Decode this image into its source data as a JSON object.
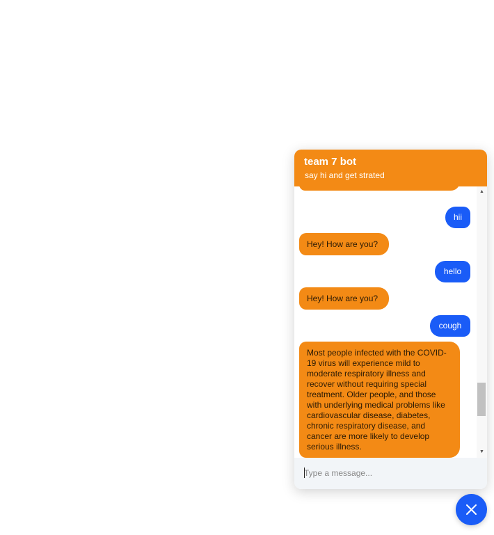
{
  "header": {
    "title": "team 7 bot",
    "subtitle": "say hi and get strated"
  },
  "messages": [
    {
      "sender": "user",
      "text": "hii"
    },
    {
      "sender": "bot",
      "text": "Hey! How are you?"
    },
    {
      "sender": "user",
      "text": "hello"
    },
    {
      "sender": "bot",
      "text": "Hey! How are you?"
    },
    {
      "sender": "user",
      "text": "cough"
    },
    {
      "sender": "bot",
      "text": "Most people infected with the COVID-19 virus will experience mild to moderate respiratory illness and recover without requiring special treatment. Older people, and those with underlying medical problems like cardiovascular disease, diabetes, chronic respiratory disease, and cancer are more likely to develop serious illness."
    }
  ],
  "input": {
    "placeholder": "Type a message...",
    "value": ""
  },
  "launcher": {
    "icon": "close-icon"
  },
  "colors": {
    "header": "#f38a15",
    "bot_bubble": "#f38a15",
    "user_bubble": "#1a5cf7",
    "input_bg": "#f2f5f8"
  }
}
